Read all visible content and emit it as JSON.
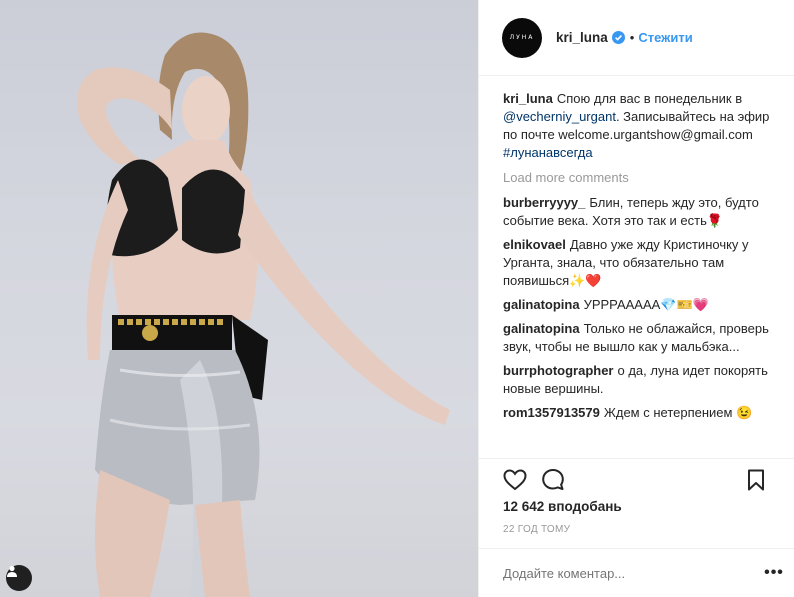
{
  "header": {
    "avatar_text": "ЛУНА",
    "username": "kri_luna",
    "dot": "•",
    "follow_label": "Стежити"
  },
  "caption": {
    "user": "kri_luna",
    "text_1": "Спою для вас в понедельник в ",
    "mention": "@vecherniy_urgant",
    "text_2": ". Записывайтесь на эфир по почте welcome.urgantshow@gmail.com ",
    "hashtag": "#лунанавсегда"
  },
  "load_more": "Load more comments",
  "comments": [
    {
      "user": "burberryyyy_",
      "text": "Блин, теперь жду это, будто событие века. Хотя это так и есть🌹"
    },
    {
      "user": "elnikovael",
      "text": "Давно уже жду Кристиночку у Урганта, знала, что обязательно там появишься✨❤️"
    },
    {
      "user": "galinatopina",
      "text": "УРРРААААА💎🎫💗"
    },
    {
      "user": "galinatopina",
      "text": "Только не облажайся, проверь звук, чтобы не вышло как у мальбэка..."
    },
    {
      "user": "burrphotographer",
      "text": "о да, луна идет покорять новые вершины."
    },
    {
      "user": "rom1357913579",
      "text": "Ждем с нетерпением 😉"
    }
  ],
  "likes": "12 642 вподобань",
  "time": "22 ГОД ТОМУ",
  "add_comment_placeholder": "Додайте коментар...",
  "more_label": "•••",
  "icons": {
    "like": "heart-outline-icon",
    "comment": "comment-bubble-icon",
    "save": "bookmark-icon",
    "tag": "person-tag-icon",
    "verified": "verified-badge-icon"
  },
  "colors": {
    "link": "#003569",
    "follow": "#3897f0",
    "verified": "#3897f0",
    "muted": "#999999"
  }
}
